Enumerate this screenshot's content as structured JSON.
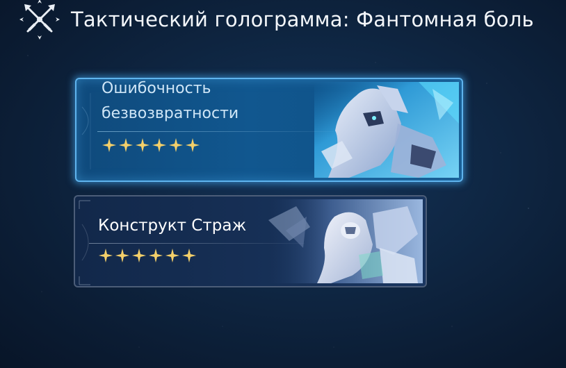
{
  "header": {
    "icon": "crossed-swords-icon",
    "title": "Тактический голограмма: Фантомная боль"
  },
  "cards": [
    {
      "name": "Ошибочность безвозвратности",
      "stars": 6,
      "selected": true,
      "portrait": "armored-character-portrait"
    },
    {
      "name": "Конструкт Страж",
      "stars": 6,
      "selected": false,
      "portrait": "guardian-construct-portrait"
    }
  ],
  "colors": {
    "star": "#f3cf6a",
    "selected_border": "#5fb4ee",
    "normal_border": "#4c5d78"
  }
}
